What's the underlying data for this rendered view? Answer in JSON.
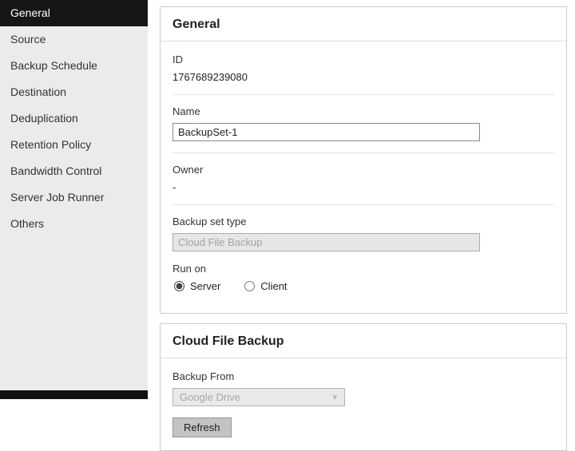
{
  "sidebar": {
    "items": [
      {
        "label": "General",
        "selected": true
      },
      {
        "label": "Source",
        "selected": false
      },
      {
        "label": "Backup Schedule",
        "selected": false
      },
      {
        "label": "Destination",
        "selected": false
      },
      {
        "label": "Deduplication",
        "selected": false
      },
      {
        "label": "Retention Policy",
        "selected": false
      },
      {
        "label": "Bandwidth Control",
        "selected": false
      },
      {
        "label": "Server Job Runner",
        "selected": false
      },
      {
        "label": "Others",
        "selected": false
      }
    ]
  },
  "general": {
    "title": "General",
    "id_label": "ID",
    "id_value": "1767689239080",
    "name_label": "Name",
    "name_value": "BackupSet-1",
    "owner_label": "Owner",
    "owner_value": "-",
    "type_label": "Backup set type",
    "type_value": "Cloud File Backup",
    "run_on_label": "Run on",
    "run_on_options": [
      {
        "label": "Server",
        "selected": true
      },
      {
        "label": "Client",
        "selected": false
      }
    ]
  },
  "cloud": {
    "title": "Cloud File Backup",
    "backup_from_label": "Backup From",
    "backup_from_value": "Google Drive",
    "refresh_label": "Refresh"
  },
  "colors": {
    "sidebar_selected_bg": "#161616",
    "sidebar_bg": "#ebebeb",
    "panel_border": "#cccccc"
  }
}
